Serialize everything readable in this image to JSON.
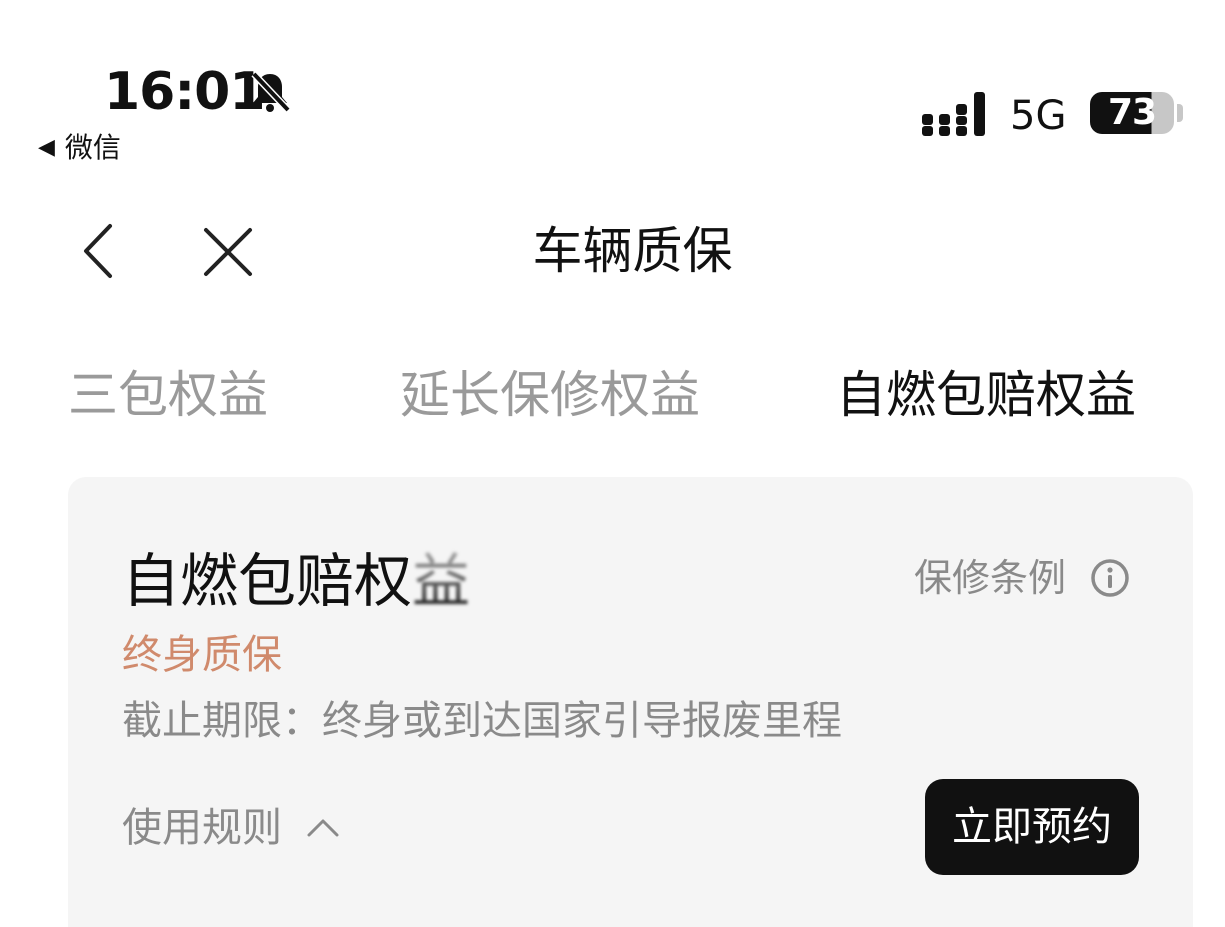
{
  "status_bar": {
    "time": "16:01",
    "back_app": "微信",
    "back_arrow": "◀",
    "network": "5G",
    "battery": "73",
    "battery_level": 0.73,
    "icons": [
      "bell-muted-icon",
      "signal-icon"
    ]
  },
  "nav": {
    "title": "车辆质保",
    "icons": [
      "chevron-left-icon",
      "close-icon"
    ]
  },
  "tabs": [
    {
      "label": "三包权益",
      "active": false
    },
    {
      "label": "延长保修权益",
      "active": false
    },
    {
      "label": "自燃包赔权益",
      "active": true
    }
  ],
  "card": {
    "title_main": "自燃包赔权",
    "title_tail": "益",
    "policy_link": "保修条例",
    "tag": "终身质保",
    "deadline": "截止期限：终身或到达国家引导报废里程",
    "rules": "使用规则",
    "book_button": "立即预约",
    "colors": {
      "tag": "#d08a6c",
      "button_bg": "#111111",
      "card_bg": "#f5f5f5"
    }
  }
}
